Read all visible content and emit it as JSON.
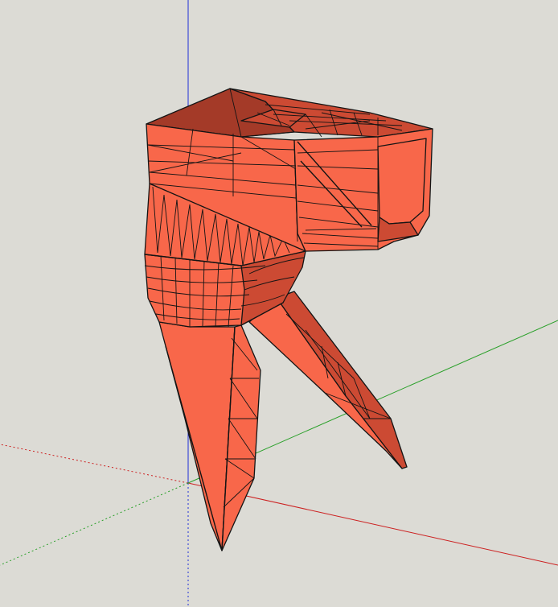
{
  "viewport": {
    "background": "#dcdbd5",
    "axes": {
      "blue": "#1f2fd8",
      "red": "#cc2020",
      "green": "#2aa02a"
    },
    "model": {
      "fill_front": "#f8674a",
      "fill_shade": "#cc4a33",
      "fill_dark": "#a43a28",
      "edge": "#141414"
    }
  }
}
